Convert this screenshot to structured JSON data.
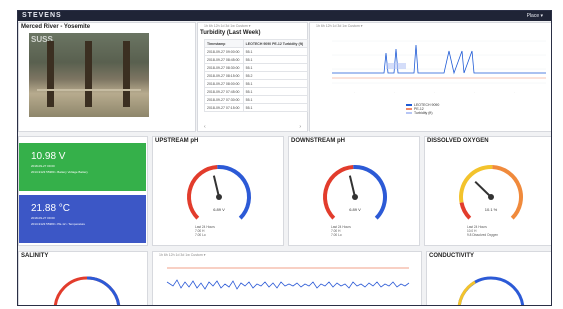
{
  "app": {
    "logo": "STEVENS",
    "top_right": "Place ▾"
  },
  "camera": {
    "title": "Merced River - Yosemite",
    "watermark": "SUSS"
  },
  "turbidity": {
    "title": "Turbidity (Last Week)",
    "tools": "1h 6h 12h 1d 3d 1w Custom ▾",
    "header_time": "Timestamp",
    "header_value": "LEOTECH 9090 PE-12 Turbidity (ft)",
    "rows": [
      [
        "2018-09-27 09:00:00",
        "55.1"
      ],
      [
        "2018-09-27 08:45:00",
        "55.1"
      ],
      [
        "2018-09-27 08:30:00",
        "55.1"
      ],
      [
        "2018-09-27 08:15:00",
        "55.2"
      ],
      [
        "2018-09-27 08:00:00",
        "55.1"
      ],
      [
        "2018-09-27 07:45:00",
        "55.1"
      ],
      [
        "2018-09-27 07:30:00",
        "55.1"
      ],
      [
        "2018-09-27 07:15:00",
        "55.1"
      ]
    ],
    "pager_prev": "‹",
    "pager_next": "›"
  },
  "top_chart": {
    "tools": "1h 6h 12h 1d 3d 1w Custom ▾",
    "legend": [
      {
        "name": "LEOTECH 9090",
        "color": "#1f5bd6"
      },
      {
        "name": "PE-12",
        "color": "#f08a6a"
      },
      {
        "name": "Turbidity (ft)",
        "color": "#b7c6f5"
      }
    ]
  },
  "voltage": {
    "value": "10.98 V",
    "sub1": "2018-09-27 09:00",
    "sub2": "2013-9123 55380 • Battery Voltage Battery",
    "color": "#35b04a"
  },
  "temperature": {
    "value": "21.88 °C",
    "sub1": "2018-09-27 09:00",
    "sub2": "2013-9123 55380 • PE-12 • Temperature",
    "color": "#3c57c6"
  },
  "gauges": [
    {
      "title": "UPSTREAM pH",
      "readout": "6.89 V",
      "meta": [
        "Last 24 Hours",
        "7.00 H",
        "7.00 Lo"
      ],
      "needle_pct": 0.45
    },
    {
      "title": "DOWNSTREAM pH",
      "readout": "6.89 V",
      "meta": [
        "Last 24 Hours",
        "7.00 H",
        "7.00 Lo"
      ],
      "needle_pct": 0.45
    },
    {
      "title": "DISSOLVED OXYGEN",
      "readout": "10.1 %",
      "meta": [
        "Last 24 Hours",
        "10.0 H",
        "9.8 Dissolved Oxygen"
      ],
      "needle_pct": 0.33
    }
  ],
  "salinity": {
    "title": "SALINITY"
  },
  "conductivity": {
    "title": "CONDUCTIVITY"
  },
  "bottom_chart": {
    "tools": "1h 6h 12h 1d 3d 1w Custom ▾"
  }
}
